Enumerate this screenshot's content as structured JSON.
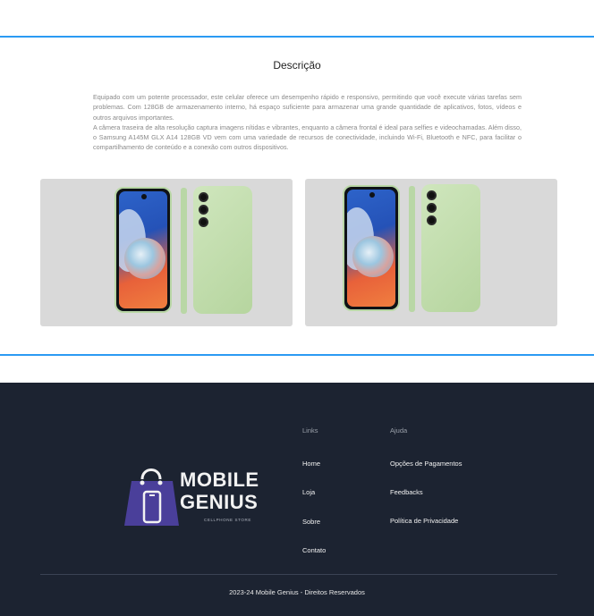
{
  "description": {
    "title": "Descrição",
    "paragraph1": "Equipado com um potente processador, este celular oferece um desempenho rápido e responsivo, permitindo que você execute várias tarefas sem problemas. Com 128GB de armazenamento interno, há espaço suficiente para armazenar uma grande quantidade de aplicativos, fotos, vídeos e outros arquivos importantes.",
    "paragraph2": "A câmera traseira de alta resolução captura imagens nítidas e vibrantes, enquanto a câmera frontal é ideal para selfies e videochamadas. Além disso, o Samsung A145M GLX A14 128GB VD vem com uma variedade de recursos de conectividade, incluindo Wi-Fi, Bluetooth e NFC, para facilitar o compartilhamento de conteúdo e a conexão com outros dispositivos."
  },
  "colors": {
    "accent_line": "#2b9af3",
    "footer_bg": "#1c2331",
    "card_bg": "#d9d9d9",
    "phone_green": "#b9d7a6",
    "logo_purple": "#4a3f9a"
  },
  "logo": {
    "line1": "MOBILE",
    "line2": "GENIUS",
    "tagline": "CELLPHONE STORE",
    "icon": "shopping-bag-phone-icon"
  },
  "footer": {
    "links": {
      "heading": "Links",
      "items": [
        "Home",
        "Loja",
        "Sobre",
        "Contato"
      ]
    },
    "help": {
      "heading": "Ajuda",
      "items": [
        "Opções de Pagamentos",
        "Feedbacks",
        "Política de Privacidade"
      ]
    },
    "copyright": "2023-24 Mobile Genius - Direitos Reservados"
  }
}
